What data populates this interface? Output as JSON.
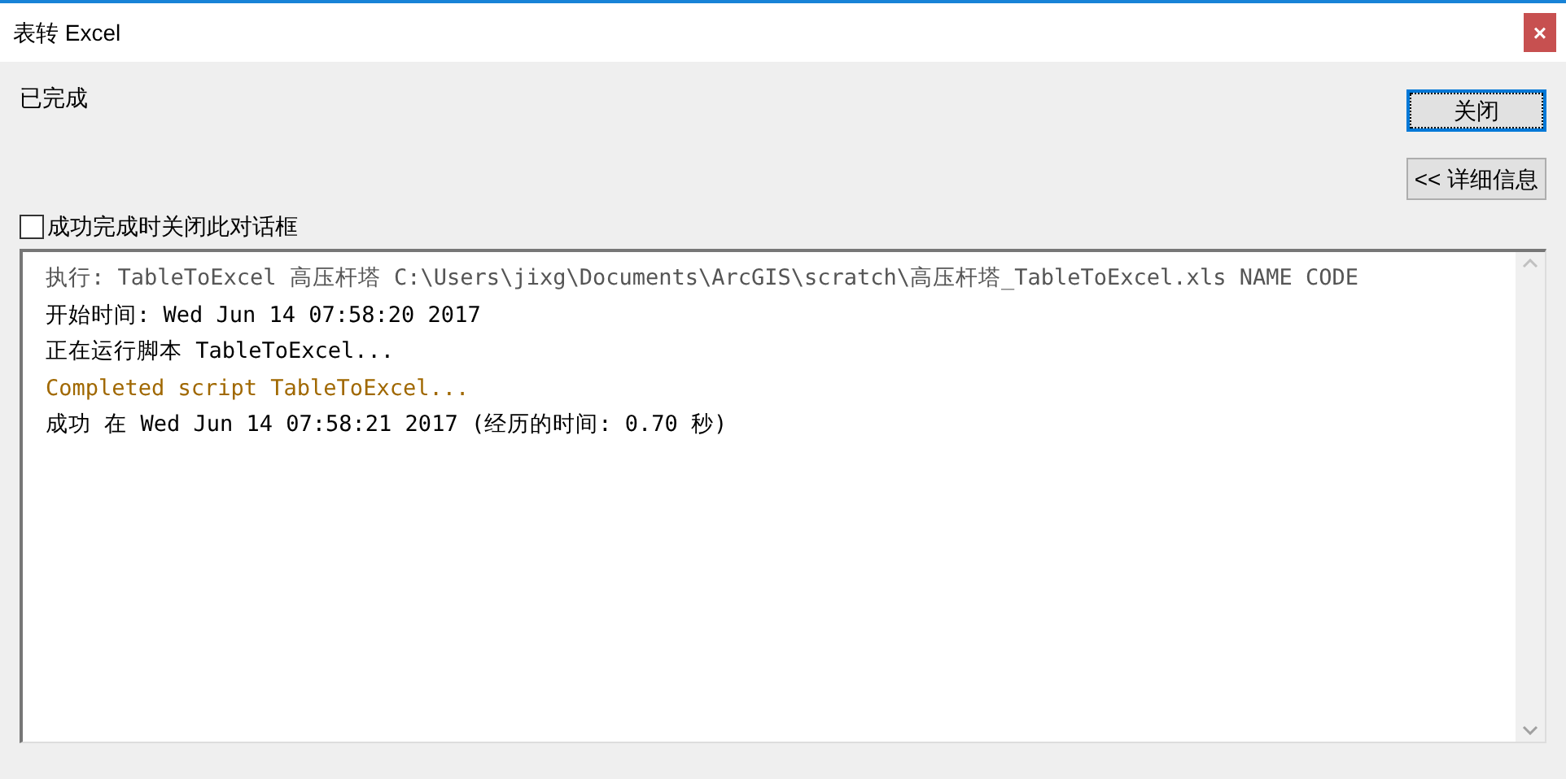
{
  "window": {
    "title": "表转 Excel",
    "close_glyph": "×"
  },
  "status": "已完成",
  "buttons": [
    {
      "label": "关闭",
      "focused": true
    },
    {
      "label": "<< 详细信息",
      "focused": false
    }
  ],
  "close_on_success": {
    "label": "成功完成时关闭此对话框",
    "checked": false
  },
  "log": [
    {
      "kind": "command",
      "text": "执行: TableToExcel 高压杆塔 C:\\Users\\jixg\\Documents\\ArcGIS\\scratch\\高压杆塔_TableToExcel.xls NAME CODE"
    },
    {
      "kind": "message",
      "text": "开始时间: Wed Jun 14 07:58:20 2017"
    },
    {
      "kind": "message",
      "text": "正在运行脚本 TableToExcel..."
    },
    {
      "kind": "script",
      "text": "Completed script TableToExcel..."
    },
    {
      "kind": "message",
      "text": "成功 在 Wed Jun 14 07:58:21 2017 (经历的时间: 0.70 秒)"
    }
  ]
}
